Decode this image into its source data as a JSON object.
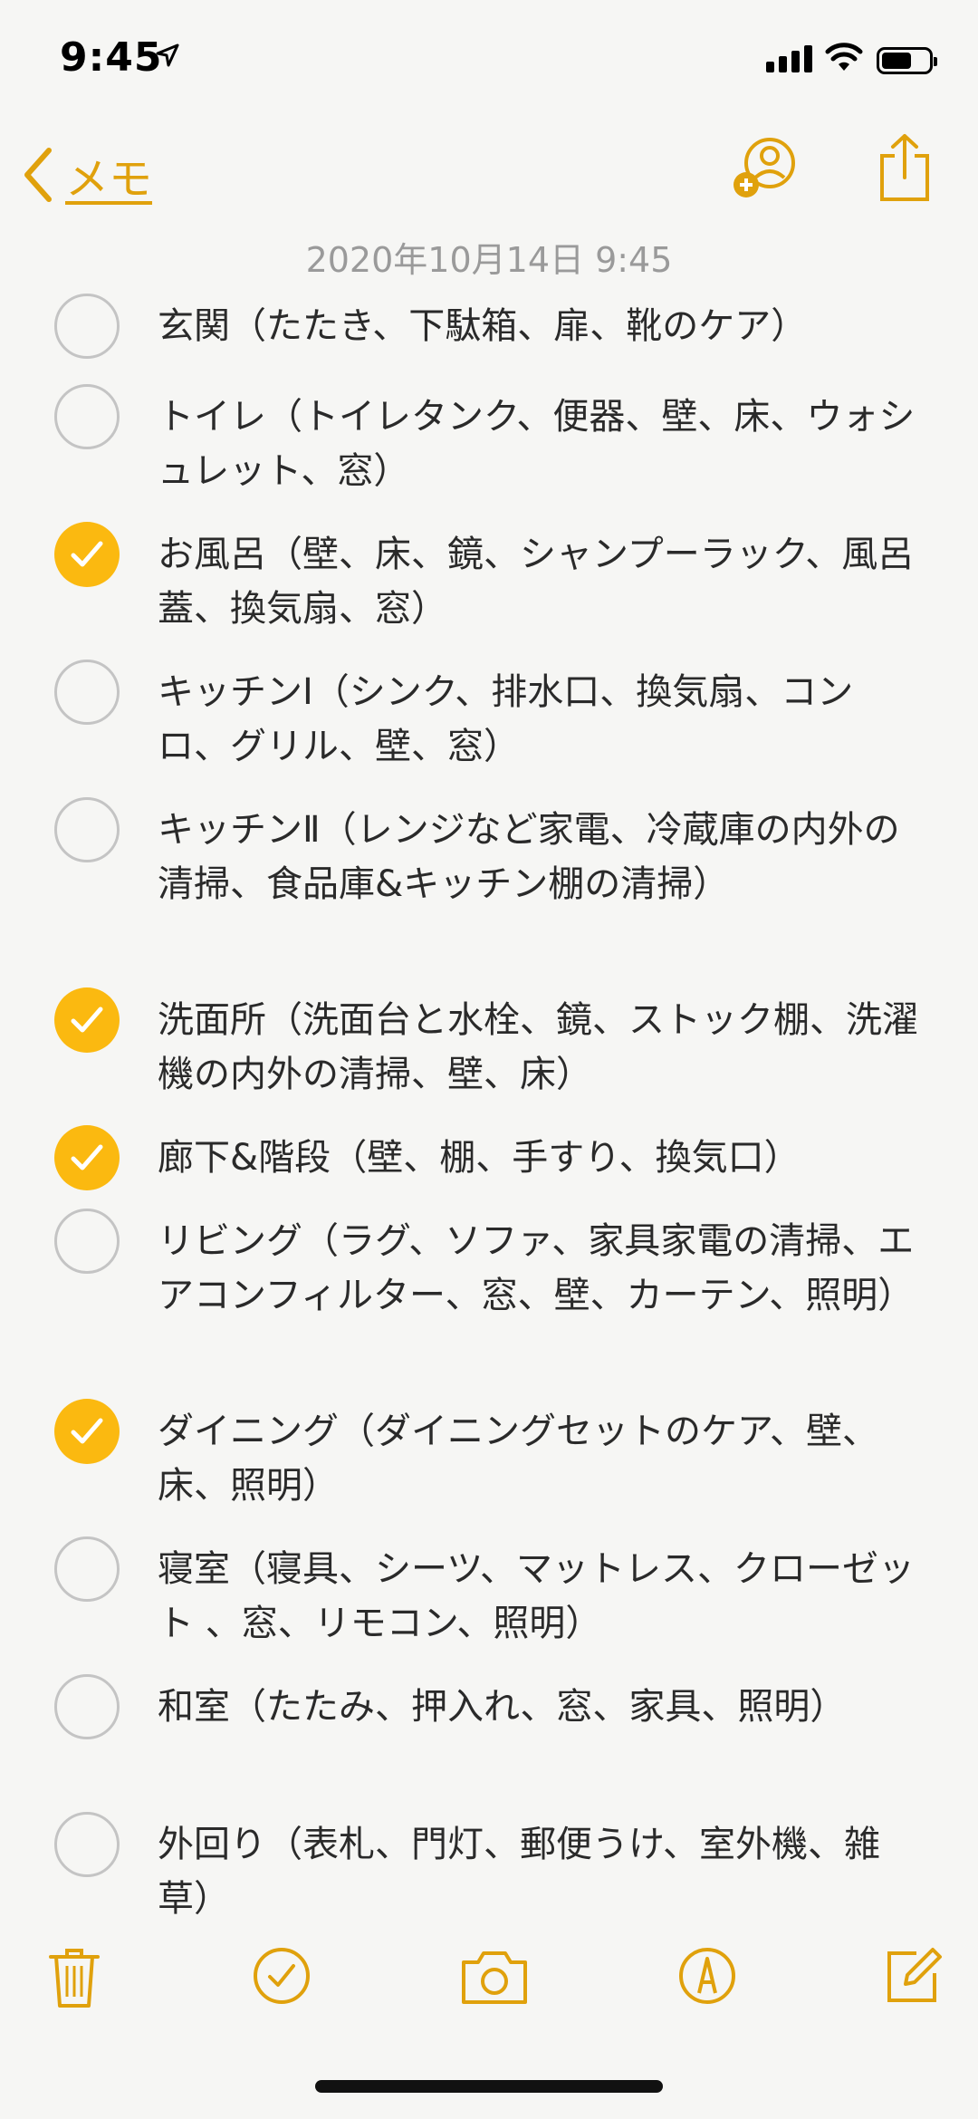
{
  "status_bar": {
    "time": "9:45"
  },
  "nav": {
    "back_label": "メモ"
  },
  "note": {
    "date": "2020年10月14日 9:45"
  },
  "checklist": [
    {
      "text": "玄関（たたき、下駄箱、扉、靴のケア）",
      "checked": false
    },
    {
      "text": "トイレ（トイレタンク、便器、壁、床、ウォシュレット、窓）",
      "checked": false
    },
    {
      "text": "お風呂（壁、床、鏡、シャンプーラック、風呂蓋、換気扇、窓）",
      "checked": true
    },
    {
      "text": "キッチンⅠ（シンク、排水口、換気扇、コンロ、グリル、壁、窓）",
      "checked": false
    },
    {
      "text": "キッチンⅡ（レンジなど家電、冷蔵庫の内外の清掃、食品庫&キッチン棚の清掃）",
      "checked": false
    },
    {
      "text": "洗面所（洗面台と水栓、鏡、ストック棚、洗濯機の内外の清掃、壁、床）",
      "checked": true
    },
    {
      "text": "廊下&階段（壁、棚、手すり、換気口）",
      "checked": true
    },
    {
      "text": "リビング（ラグ、ソファ、家具家電の清掃、エアコンフィルター、窓、壁、カーテン、照明）",
      "checked": false
    },
    {
      "text": "ダイニング（ダイニングセットのケア、壁、床、照明）",
      "checked": true
    },
    {
      "text": "寝室（寝具、シーツ、マットレス、クローゼット 、窓、リモコン、照明）",
      "checked": false
    },
    {
      "text": "和室（たたみ、押入れ、窓、家具、照明）",
      "checked": false
    },
    {
      "text": "外回り（表札、門灯、郵便うけ、室外機、雑草）",
      "checked": false
    }
  ],
  "colors": {
    "accent": "#e0a10c",
    "check_fill": "#fbb910",
    "unchecked_border": "#c4c4c4"
  },
  "icons": {
    "nav": [
      "chevron-left-icon",
      "add-person-icon",
      "share-icon"
    ],
    "toolbar": [
      "trash-icon",
      "checklist-icon",
      "camera-icon",
      "markup-icon",
      "compose-icon"
    ]
  }
}
